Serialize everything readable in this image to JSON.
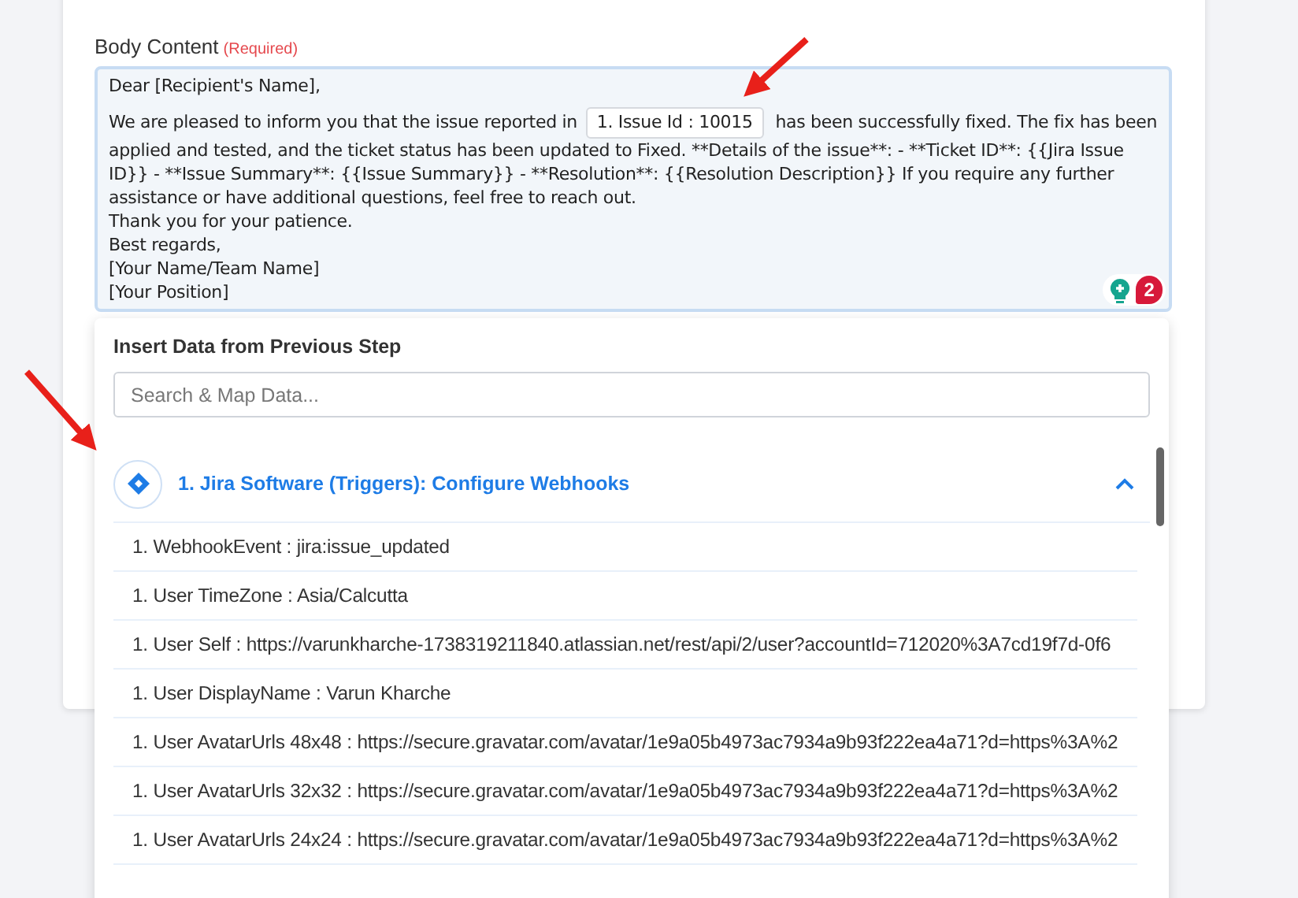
{
  "body_content": {
    "label": "Body Content",
    "required_note": "(Required)",
    "greeting": "Dear [Recipient's Name],",
    "paragraph": {
      "before": "We are pleased to inform you that the issue reported in",
      "token": "1. Issue Id : 10015",
      "after": "has been successfully fixed. The fix has been applied and tested, and the ticket status has been updated to Fixed. **Details of the issue**: - **Ticket ID**: {{Jira Issue ID}} - **Issue Summary**: {{Issue Summary}} - **Resolution**: {{Resolution Description}} If you require any further assistance or have additional questions, feel free to reach out."
    },
    "closing_lines": [
      "Thank you for your patience.",
      "Best regards,",
      "[Your Name/Team Name]",
      "[Your Position]"
    ],
    "suggestion_count": "2"
  },
  "data_panel": {
    "title": "Insert Data from Previous Step",
    "search": {
      "placeholder": "Search & Map Data..."
    },
    "group": {
      "title": "1. Jira Software (Triggers): Configure Webhooks",
      "expanded": true,
      "items": [
        "1. WebhookEvent : jira:issue_updated",
        "1. User TimeZone : Asia/Calcutta",
        "1. User Self : https://varunkharche-1738319211840.atlassian.net/rest/api/2/user?accountId=712020%3A7cd19f7d-0f6",
        "1. User DisplayName : Varun Kharche",
        "1. User AvatarUrls 48x48 : https://secure.gravatar.com/avatar/1e9a05b4973ac7934a9b93f222ea4a71?d=https%3A%2",
        "1. User AvatarUrls 32x32 : https://secure.gravatar.com/avatar/1e9a05b4973ac7934a9b93f222ea4a71?d=https%3A%2",
        "1. User AvatarUrls 24x24 : https://secure.gravatar.com/avatar/1e9a05b4973ac7934a9b93f222ea4a71?d=https%3A%2"
      ]
    }
  }
}
